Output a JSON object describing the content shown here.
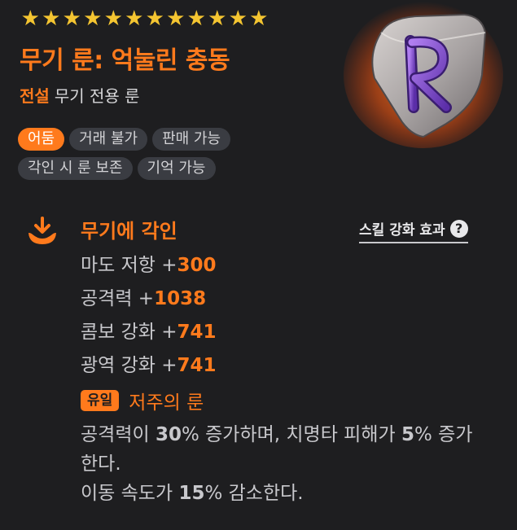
{
  "stars": [
    "★",
    "★",
    "★",
    "★",
    "★",
    "★",
    "★",
    "★",
    "★",
    "★",
    "★",
    "★"
  ],
  "item": {
    "name": "무기 룬: 억눌린 충동",
    "grade": "전설",
    "type": "무기 전용 룬",
    "rune_letter": "R"
  },
  "tags": [
    "어둠",
    "거래 불가",
    "판매 가능",
    "각인 시 룬 보존",
    "기억 가능"
  ],
  "engrave": {
    "title": "무기에 각인",
    "skill_link": "스킬 강화 효과",
    "help": "?"
  },
  "stats": [
    {
      "label": "마도 저항 +",
      "value": "300"
    },
    {
      "label": "공격력 +",
      "value": "1038"
    },
    {
      "label": "콤보 강화 +",
      "value": "741"
    },
    {
      "label": "광역 강화 +",
      "value": "741"
    }
  ],
  "unique": {
    "badge": "유일",
    "name": "저주의 룬"
  },
  "description": {
    "p1": "공격력이 ",
    "v1": "30",
    "p2": "% 증가하며, 치명타 피해가 ",
    "v2": "5",
    "p3": "% 증가한다.",
    "p4": "이동 속도가 ",
    "v3": "15",
    "p5": "% 감소한다."
  },
  "colors": {
    "accent": "#ff7a1c",
    "star": "#f4c531",
    "background": "#1e1e20",
    "tag_bg": "#3a3c42"
  }
}
